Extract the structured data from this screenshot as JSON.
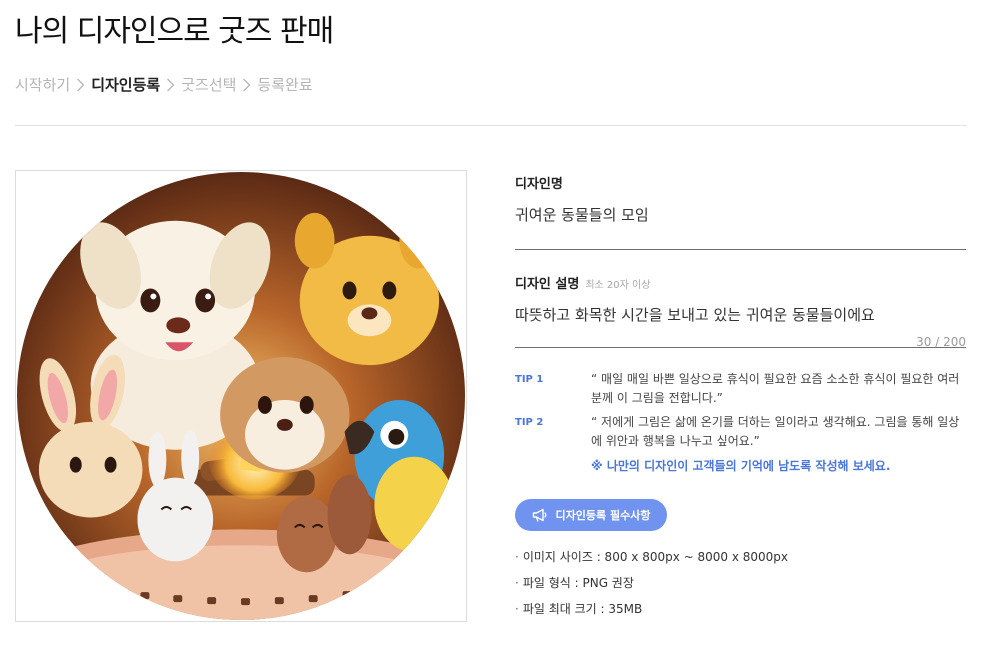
{
  "page": {
    "title": "나의 디자인으로 굿즈 판매"
  },
  "breadcrumb": {
    "steps": [
      {
        "label": "시작하기",
        "active": false
      },
      {
        "label": "디자인등록",
        "active": true
      },
      {
        "label": "굿즈선택",
        "active": false
      },
      {
        "label": "등록완료",
        "active": false
      }
    ]
  },
  "form": {
    "name": {
      "label": "디자인명",
      "value": "귀여운 동물들의 모임"
    },
    "description": {
      "label": "디자인 설명",
      "hint": "최소 20자 이상",
      "value": "따뜻하고 화목한 시간을 보내고 있는 귀여운 동물들이에요",
      "counter": "30 / 200"
    },
    "tips": [
      {
        "label": "TIP 1",
        "text": "“ 매일 매일 바쁜 일상으로 휴식이 필요한 요즘 소소한 휴식이 필요한 여러분께 이 그림을 전합니다.”"
      },
      {
        "label": "TIP 2",
        "text": "“ 저에게 그림은 삶에 온기를 더하는 일이라고 생각해요. 그림을 통해 일상에 위안과 행복을 나누고 싶어요.”"
      }
    ],
    "tip_note": "※ 나만의 디자인이 고객들의 기억에 남도록 작성해 보세요.",
    "requirements_button": "디자인등록 필수사항",
    "requirements": [
      "이미지 사이즈 : 800 x 800px ~ 8000 x 8000px",
      "파일 형식 : PNG 권장",
      "파일 최대 크기 : 35MB"
    ]
  },
  "colors": {
    "accent": "#6f93ee",
    "tip_blue": "#4a76d9",
    "divider": "#e3e3e3"
  },
  "icons": {
    "breadcrumb_separator": "chevron-right-icon",
    "requirements_button": "megaphone-icon"
  }
}
